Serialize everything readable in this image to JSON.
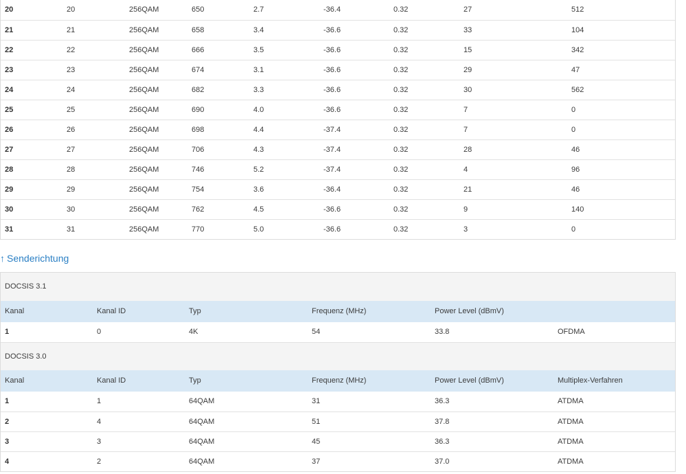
{
  "downstream_rows": [
    [
      "20",
      "20",
      "256QAM",
      "650",
      "2.7",
      "-36.4",
      "0.32",
      "27",
      "512"
    ],
    [
      "21",
      "21",
      "256QAM",
      "658",
      "3.4",
      "-36.6",
      "0.32",
      "33",
      "104"
    ],
    [
      "22",
      "22",
      "256QAM",
      "666",
      "3.5",
      "-36.6",
      "0.32",
      "15",
      "342"
    ],
    [
      "23",
      "23",
      "256QAM",
      "674",
      "3.1",
      "-36.6",
      "0.32",
      "29",
      "47"
    ],
    [
      "24",
      "24",
      "256QAM",
      "682",
      "3.3",
      "-36.6",
      "0.32",
      "30",
      "562"
    ],
    [
      "25",
      "25",
      "256QAM",
      "690",
      "4.0",
      "-36.6",
      "0.32",
      "7",
      "0"
    ],
    [
      "26",
      "26",
      "256QAM",
      "698",
      "4.4",
      "-37.4",
      "0.32",
      "7",
      "0"
    ],
    [
      "27",
      "27",
      "256QAM",
      "706",
      "4.3",
      "-37.4",
      "0.32",
      "28",
      "46"
    ],
    [
      "28",
      "28",
      "256QAM",
      "746",
      "5.2",
      "-37.4",
      "0.32",
      "4",
      "96"
    ],
    [
      "29",
      "29",
      "256QAM",
      "754",
      "3.6",
      "-36.4",
      "0.32",
      "21",
      "46"
    ],
    [
      "30",
      "30",
      "256QAM",
      "762",
      "4.5",
      "-36.6",
      "0.32",
      "9",
      "140"
    ],
    [
      "31",
      "31",
      "256QAM",
      "770",
      "5.0",
      "-36.6",
      "0.32",
      "3",
      "0"
    ]
  ],
  "upstream": {
    "title": "Senderichtung",
    "arrow": "↑",
    "docsis31": {
      "group_label": "DOCSIS 3.1",
      "headers": [
        "Kanal",
        "Kanal ID",
        "Typ",
        "Frequenz (MHz)",
        "Power Level (dBmV)",
        ""
      ],
      "rows": [
        [
          "1",
          "0",
          "4K",
          "54",
          "33.8",
          "OFDMA"
        ]
      ]
    },
    "docsis30": {
      "group_label": "DOCSIS 3.0",
      "headers": [
        "Kanal",
        "Kanal ID",
        "Typ",
        "Frequenz (MHz)",
        "Power Level (dBmV)",
        "Multiplex-Verfahren"
      ],
      "rows": [
        [
          "1",
          "1",
          "64QAM",
          "31",
          "36.3",
          "ATDMA"
        ],
        [
          "2",
          "4",
          "64QAM",
          "51",
          "37.8",
          "ATDMA"
        ],
        [
          "3",
          "3",
          "64QAM",
          "45",
          "36.3",
          "ATDMA"
        ],
        [
          "4",
          "2",
          "64QAM",
          "37",
          "37.0",
          "ATDMA"
        ]
      ]
    }
  }
}
